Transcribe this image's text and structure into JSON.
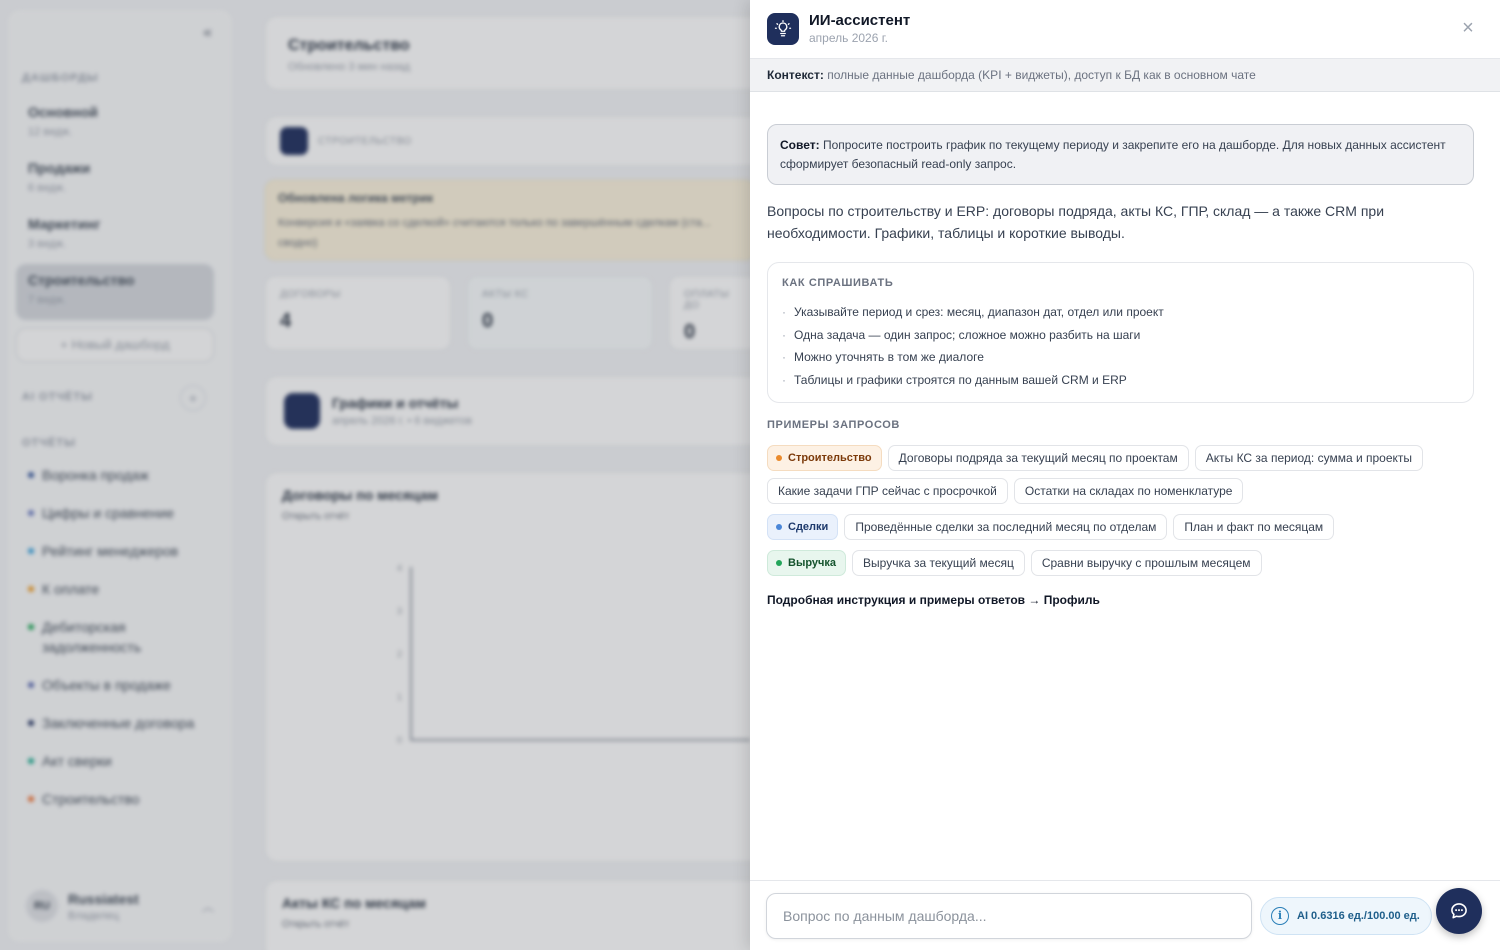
{
  "sidebar": {
    "section_dashboards": "ДАШБОРДЫ",
    "dashboards": [
      {
        "title": "Основной",
        "sub": "12 видж."
      },
      {
        "title": "Продажи",
        "sub": "6 видж."
      },
      {
        "title": "Маркетинг",
        "sub": "3 видж."
      },
      {
        "title": "Строительство",
        "sub": "7 видж."
      }
    ],
    "new_dashboard": "+ Новый дашборд",
    "section_ai_reports": "AI ОТЧЁТЫ",
    "section_reports": "ОТЧЁТЫ",
    "reports": [
      {
        "label": "Воронка продаж",
        "color": "#3b5b9e"
      },
      {
        "label": "Цифры и сравнение",
        "color": "#6b7bbf"
      },
      {
        "label": "Рейтинг менеджеров",
        "color": "#3aa0d8"
      },
      {
        "label": "К оплате",
        "color": "#e89b2c"
      },
      {
        "label": "Дебиторская задолженность",
        "color": "#22a55a"
      },
      {
        "label": "Объекты в продаже",
        "color": "#5b6bb0"
      },
      {
        "label": "Заключенные договора",
        "color": "#2b3a67"
      },
      {
        "label": "Акт сверки",
        "color": "#1fa88f"
      },
      {
        "label": "Строительство",
        "color": "#e8743b"
      }
    ],
    "user": {
      "initials": "RU",
      "name": "Russiatest",
      "role": "Владелец"
    }
  },
  "dashboard": {
    "title": "Строительство",
    "updated": "Обновлено 3 мин назад",
    "tag_label": "СТРОИТЕЛЬСТВО",
    "notice_title": "Обновлена логика метрик",
    "notice_body": "Конверсия и «заявка со сделкой» считаются только по завершённым сделкам (ста... сводно)",
    "kpis": [
      {
        "label": "ДОГОВОРЫ",
        "value": "4"
      },
      {
        "label": "АКТЫ КС",
        "value": "0"
      },
      {
        "label": "ОПЛАТЫ ДО",
        "value": "0"
      }
    ],
    "charts_title": "Графики и отчёты",
    "charts_sub": "апрель 2026 г. • 6 виджетов",
    "chart1_title": "Договоры по месяцам",
    "chart1_link": "Открыть отчёт",
    "chart1_ticks": [
      "4",
      "3",
      "2",
      "1",
      "0"
    ],
    "chart2_title": "Акты КС по месяцам",
    "chart2_link": "Открыть отчёт"
  },
  "assistant": {
    "title": "ИИ-ассистент",
    "date": "апрель 2026 г.",
    "context_label": "Контекст:",
    "context_text": " полные данные дашборда (KPI + виджеты), доступ к БД как в основном чате",
    "tip_label": "Совет:",
    "tip_text": " Попросите построить график по текущему периоду и закрепите его на дашборде. Для новых данных ассистент сформирует безопасный read-only запрос.",
    "intro": "Вопросы по строительству и ERP: договоры подряда, акты КС, ГПР, склад — а также CRM при необходимости. Графики, таблицы и короткие выводы.",
    "how_title": "КАК СПРАШИВАТЬ",
    "how_items": [
      "Указывайте период и срез: месяц, диапазон дат, отдел или проект",
      "Одна задача — один запрос; сложное можно разбить на шаги",
      "Можно уточнять в том же диалоге",
      "Таблицы и графики строятся по данным вашей CRM и ERP"
    ],
    "examples_title": "ПРИМЕРЫ ЗАПРОСОВ",
    "tags": {
      "construction": "Строительство",
      "deals": "Сделки",
      "revenue": "Выручка"
    },
    "examples": {
      "construction": [
        "Договоры подряда за текущий месяц по проектам",
        "Акты КС за период: сумма и проекты",
        "Какие задачи ГПР сейчас с просрочкой",
        "Остатки на складах по номенклатуре"
      ],
      "deals": [
        "Проведённые сделки за последний месяц по отделам",
        "План и факт по месяцам"
      ],
      "revenue": [
        "Выручка за текущий месяц",
        "Сравни выручку с прошлым месяцем"
      ]
    },
    "guide_text": "Подробная инструкция и примеры ответов → Профиль",
    "input_placeholder": "Вопрос по данным дашборда...",
    "quota": "AI 0.6316 ед./100.00 ед.",
    "colors": {
      "navy": "#1f2f5c",
      "orange": "#ea8a2c",
      "blue": "#4a86d8",
      "green": "#22a55a"
    }
  }
}
